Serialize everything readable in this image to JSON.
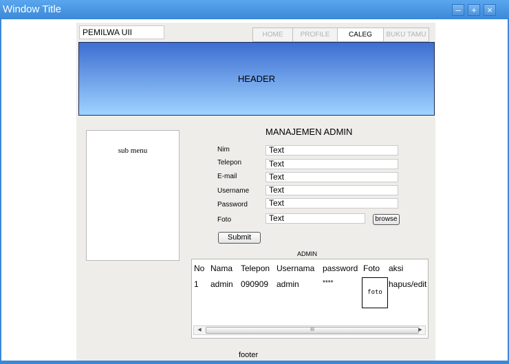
{
  "window": {
    "title": "Window Title",
    "controls": {
      "minimize": "–",
      "maximize": "+",
      "close": "×"
    }
  },
  "site": {
    "title": "PEMILWA UII"
  },
  "nav": {
    "tabs": [
      {
        "label": "HOME",
        "active": false
      },
      {
        "label": "PROFILE",
        "active": false
      },
      {
        "label": "CALEG",
        "active": true
      },
      {
        "label": "BUKU TAMU",
        "active": false
      }
    ]
  },
  "header": {
    "label": "HEADER"
  },
  "sidebar": {
    "label": "sub menu"
  },
  "form": {
    "title": "MANAJEMEN ADMIN",
    "fields": [
      {
        "label": "Nim",
        "value": "Text"
      },
      {
        "label": "Telepon",
        "value": "Text"
      },
      {
        "label": "E-mail",
        "value": "Text"
      },
      {
        "label": "Username",
        "value": "Text"
      },
      {
        "label": "Password",
        "value": "Text"
      },
      {
        "label": "Foto",
        "value": "Text"
      }
    ],
    "browse_label": "browse",
    "submit_label": "Submit"
  },
  "admin_table": {
    "caption": "ADMIN",
    "headers": [
      "No",
      "Nama",
      "Telepon",
      "Usernama",
      "password",
      "Foto",
      "aksi"
    ],
    "rows": [
      {
        "no": "1",
        "nama": "admin",
        "telepon": "090909",
        "username": "admin",
        "password": "****",
        "foto": "foto",
        "aksi": "hapus/edit"
      }
    ],
    "scrollbar": {
      "left_arrow": "◀",
      "thumb_grip": "III",
      "right_arrow": "▶"
    }
  },
  "footer": {
    "label": "footer"
  },
  "colors": {
    "titlebar": "#3b88d8",
    "page_background": "#efedea",
    "header_gradient_top": "#3d6ed2",
    "header_gradient_bottom": "#9fd3ff"
  }
}
